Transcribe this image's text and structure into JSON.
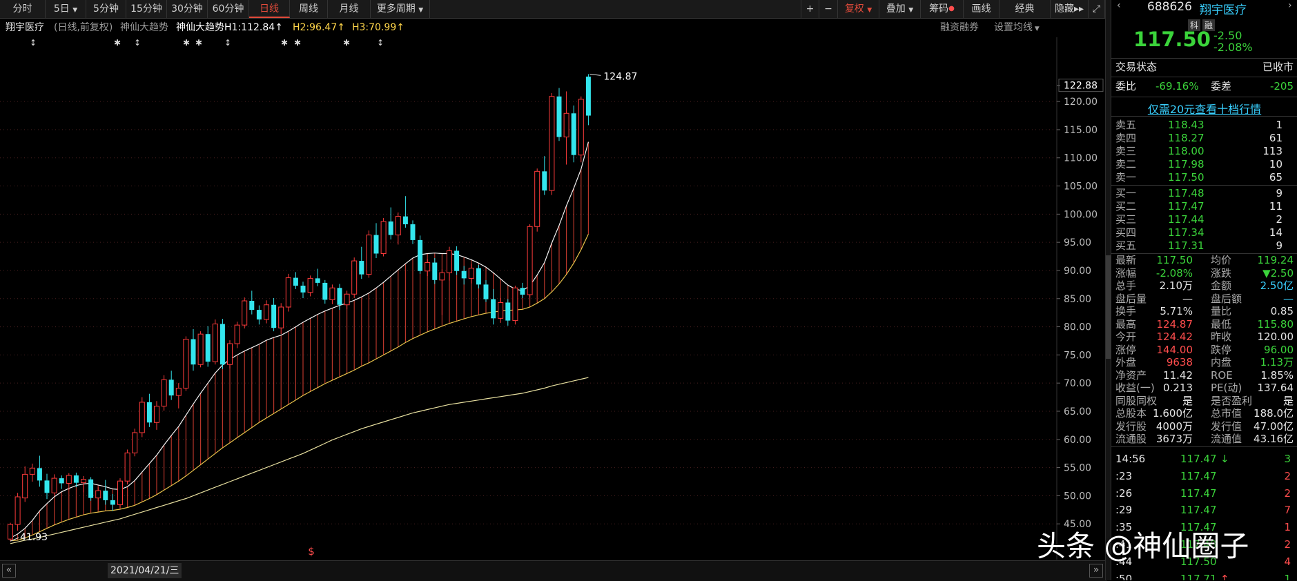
{
  "toolbar": {
    "periods": [
      "分时",
      "5日",
      "5分钟",
      "15分钟",
      "30分钟",
      "60分钟",
      "日线",
      "周线",
      "月线",
      "更多周期"
    ],
    "active_period": "日线",
    "plus": "+",
    "minus": "−",
    "fuquan": "复权",
    "diejia": "叠加",
    "chouma": "筹码",
    "huaxian": "画线",
    "jingdian": "经典",
    "yincang": "隐藏"
  },
  "infobar": {
    "stock_name": "翔宇医疗",
    "mode": "(日线,前复权)",
    "indicator": "神仙大趋势",
    "h1": "神仙大趋势H1:112.84",
    "h2": "H2:96.47",
    "h3": "H3:70.99",
    "margin_link": "融资融券",
    "ma_setting": "设置均线"
  },
  "chart_data": {
    "type": "candlestick",
    "price_axis": [
      122.88,
      120.0,
      115.0,
      110.0,
      105.0,
      100.0,
      95.0,
      90.0,
      85.0,
      80.0,
      75.0,
      70.0,
      65.0,
      60.0,
      55.0,
      50.0,
      45.0
    ],
    "ylim": [
      40.0,
      127.0
    ],
    "high_label": "124.87",
    "low_label": "41.93",
    "date_label": "2021/04/21/三",
    "ohlc": [
      [
        42.3,
        45.2,
        41.93,
        44.9
      ],
      [
        44.9,
        50.5,
        43.8,
        49.8
      ],
      [
        49.6,
        55.2,
        48.9,
        53.8
      ],
      [
        53.8,
        55.7,
        52.5,
        54.9
      ],
      [
        54.9,
        57.1,
        51.6,
        52.7
      ],
      [
        52.7,
        53.9,
        49.4,
        50.5
      ],
      [
        50.5,
        53.8,
        49.9,
        53.1
      ],
      [
        53.1,
        53.6,
        51.2,
        52.2
      ],
      [
        52.2,
        54.0,
        51.0,
        53.6
      ],
      [
        53.6,
        54.1,
        51.5,
        52.3
      ],
      [
        52.3,
        53.5,
        50.6,
        52.9
      ],
      [
        52.9,
        53.3,
        49.1,
        49.6
      ],
      [
        49.6,
        51.5,
        47.5,
        50.9
      ],
      [
        50.9,
        52.8,
        48.4,
        49.2
      ],
      [
        49.2,
        50.3,
        47.3,
        48.4
      ],
      [
        48.4,
        53.1,
        47.9,
        52.6
      ],
      [
        52.6,
        58.2,
        52.0,
        57.6
      ],
      [
        57.6,
        61.9,
        57.0,
        61.2
      ],
      [
        61.2,
        67.5,
        60.4,
        66.6
      ],
      [
        66.6,
        68.1,
        62.2,
        63.0
      ],
      [
        63.0,
        66.8,
        61.7,
        65.9
      ],
      [
        65.9,
        71.4,
        65.1,
        70.6
      ],
      [
        70.6,
        72.2,
        67.0,
        67.8
      ],
      [
        67.8,
        70.0,
        65.5,
        69.1
      ],
      [
        69.1,
        78.3,
        68.6,
        77.8
      ],
      [
        77.8,
        79.6,
        72.2,
        73.3
      ],
      [
        73.3,
        79.2,
        72.8,
        78.7
      ],
      [
        78.7,
        80.1,
        72.9,
        73.8
      ],
      [
        73.8,
        81.3,
        73.3,
        80.5
      ],
      [
        80.5,
        81.4,
        72.5,
        73.3
      ],
      [
        73.3,
        77.6,
        72.6,
        77.0
      ],
      [
        77.0,
        80.9,
        76.2,
        80.3
      ],
      [
        80.3,
        85.2,
        79.7,
        84.6
      ],
      [
        84.6,
        86.4,
        82.2,
        83.0
      ],
      [
        83.0,
        83.8,
        80.4,
        81.3
      ],
      [
        81.3,
        84.7,
        80.6,
        83.9
      ],
      [
        83.9,
        85.1,
        79.2,
        79.8
      ],
      [
        79.8,
        84.2,
        78.7,
        83.5
      ],
      [
        83.5,
        89.4,
        82.7,
        88.7
      ],
      [
        88.7,
        89.7,
        86.7,
        87.3
      ],
      [
        87.3,
        88.0,
        85.1,
        86.1
      ],
      [
        86.1,
        89.1,
        85.4,
        88.6
      ],
      [
        88.6,
        90.3,
        87.2,
        87.8
      ],
      [
        87.8,
        88.3,
        84.1,
        84.8
      ],
      [
        84.8,
        87.5,
        84.0,
        86.9
      ],
      [
        86.9,
        87.6,
        83.0,
        83.9
      ],
      [
        83.9,
        86.4,
        83.1,
        85.8
      ],
      [
        85.8,
        92.3,
        85.1,
        91.7
      ],
      [
        91.7,
        94.2,
        88.5,
        89.3
      ],
      [
        89.3,
        97.1,
        88.7,
        96.3
      ],
      [
        96.3,
        98.4,
        92.2,
        93.0
      ],
      [
        93.0,
        99.3,
        92.5,
        98.7
      ],
      [
        98.7,
        101.2,
        95.5,
        96.3
      ],
      [
        96.3,
        100.3,
        94.6,
        99.6
      ],
      [
        99.6,
        103.2,
        97.6,
        98.2
      ],
      [
        98.2,
        98.9,
        94.7,
        95.4
      ],
      [
        95.4,
        96.2,
        89.4,
        89.9
      ],
      [
        89.9,
        92.0,
        89.0,
        91.4
      ],
      [
        91.4,
        92.2,
        87.6,
        88.3
      ],
      [
        88.3,
        90.2,
        82.1,
        89.6
      ],
      [
        89.6,
        94.2,
        88.2,
        93.5
      ],
      [
        93.5,
        94.3,
        89.2,
        89.9
      ],
      [
        89.9,
        90.8,
        87.5,
        88.6
      ],
      [
        88.6,
        91.2,
        87.7,
        90.4
      ],
      [
        90.4,
        91.0,
        86.8,
        87.5
      ],
      [
        87.5,
        88.3,
        84.4,
        84.9
      ],
      [
        84.9,
        86.7,
        80.4,
        81.5
      ],
      [
        81.5,
        85.1,
        80.7,
        84.3
      ],
      [
        84.3,
        84.9,
        80.2,
        81.1
      ],
      [
        81.1,
        87.3,
        80.4,
        86.9
      ],
      [
        86.9,
        87.8,
        85.1,
        85.7
      ],
      [
        85.7,
        98.2,
        85.2,
        97.8
      ],
      [
        97.8,
        108.1,
        96.9,
        107.6
      ],
      [
        107.6,
        110.3,
        103.4,
        104.2
      ],
      [
        104.2,
        121.5,
        103.4,
        120.9
      ],
      [
        120.9,
        122.4,
        113.0,
        113.7
      ],
      [
        113.7,
        121.8,
        108.8,
        117.9
      ],
      [
        117.9,
        119.3,
        109.2,
        110.5
      ],
      [
        110.5,
        120.9,
        109.2,
        120.4
      ],
      [
        124.42,
        124.87,
        115.8,
        117.5
      ]
    ],
    "lines": {
      "h1": [
        42.5,
        43.2,
        44.2,
        45.6,
        47.3,
        48.6,
        49.8,
        50.7,
        51.3,
        51.8,
        52.1,
        52.2,
        51.9,
        51.6,
        51.2,
        51.1,
        51.6,
        52.7,
        54.2,
        55.7,
        57.2,
        59.0,
        60.7,
        62.3,
        64.3,
        66.3,
        68.2,
        70.0,
        71.8,
        73.2,
        74.2,
        75.0,
        75.7,
        76.3,
        76.9,
        77.6,
        78.1,
        78.5,
        79.2,
        80.0,
        80.8,
        81.5,
        82.2,
        82.8,
        83.3,
        83.8,
        84.2,
        84.7,
        85.3,
        86.0,
        86.9,
        87.9,
        89.0,
        90.1,
        91.2,
        92.2,
        92.8,
        93.0,
        93.1,
        93.0,
        93.0,
        92.8,
        92.4,
        91.9,
        91.3,
        90.6,
        89.6,
        88.5,
        87.4,
        86.7,
        86.4,
        87.3,
        89.2,
        91.4,
        94.9,
        98.0,
        101.5,
        104.6,
        108.0,
        112.84
      ],
      "h2": [
        42.0,
        42.1,
        42.5,
        43.0,
        43.6,
        44.2,
        44.8,
        45.3,
        45.8,
        46.2,
        46.6,
        46.9,
        47.1,
        47.3,
        47.4,
        47.6,
        47.9,
        48.3,
        48.9,
        49.5,
        50.2,
        51.0,
        51.8,
        52.6,
        53.5,
        54.5,
        55.5,
        56.5,
        57.5,
        58.5,
        59.4,
        60.3,
        61.2,
        62.1,
        63.0,
        63.8,
        64.6,
        65.4,
        66.2,
        67.0,
        67.8,
        68.5,
        69.2,
        69.9,
        70.5,
        71.1,
        71.7,
        72.3,
        73.0,
        73.6,
        74.3,
        75.0,
        75.7,
        76.4,
        77.2,
        77.9,
        78.5,
        79.1,
        79.6,
        80.1,
        80.6,
        81.0,
        81.4,
        81.8,
        82.1,
        82.4,
        82.6,
        82.8,
        82.9,
        83.0,
        83.1,
        83.5,
        84.2,
        85.0,
        86.2,
        87.6,
        89.3,
        91.3,
        93.7,
        96.47
      ],
      "h3": [
        41.5,
        41.8,
        42.1,
        42.3,
        42.6,
        42.9,
        43.2,
        43.5,
        43.8,
        44.1,
        44.4,
        44.7,
        45.0,
        45.3,
        45.6,
        45.9,
        46.3,
        46.7,
        47.1,
        47.5,
        47.9,
        48.3,
        48.7,
        49.1,
        49.5,
        50.0,
        50.5,
        51.0,
        51.5,
        52.0,
        52.5,
        53.0,
        53.5,
        54.0,
        54.5,
        55.0,
        55.5,
        56.0,
        56.5,
        57.0,
        57.5,
        58.1,
        58.7,
        59.3,
        59.9,
        60.4,
        60.9,
        61.4,
        61.9,
        62.3,
        62.7,
        63.1,
        63.5,
        63.9,
        64.3,
        64.7,
        65.0,
        65.3,
        65.6,
        65.9,
        66.2,
        66.4,
        66.6,
        66.8,
        67.0,
        67.2,
        67.4,
        67.6,
        67.8,
        68.0,
        68.2,
        68.5,
        68.8,
        69.1,
        69.5,
        69.8,
        70.1,
        70.4,
        70.7,
        70.99
      ]
    }
  },
  "bottombar": {
    "prev": "«",
    "next": "»"
  },
  "panel": {
    "code": "688626",
    "name": "翔宇医疗",
    "tag_ke": "科",
    "tag_rong": "融",
    "price": "117.50",
    "change": "-2.50",
    "change_pct": "-2.08%",
    "trade_status_label": "交易状态",
    "trade_status_value": "已收市",
    "weibi_label": "委比",
    "weibi_value": "-69.16%",
    "weicha_label": "委差",
    "weicha_value": "-205",
    "promo": "仅需20元查看十档行情",
    "asks": [
      {
        "label": "卖五",
        "price": "118.43",
        "vol": "1"
      },
      {
        "label": "卖四",
        "price": "118.27",
        "vol": "61"
      },
      {
        "label": "卖三",
        "price": "118.00",
        "vol": "113"
      },
      {
        "label": "卖二",
        "price": "117.98",
        "vol": "10"
      },
      {
        "label": "卖一",
        "price": "117.50",
        "vol": "65"
      }
    ],
    "bids": [
      {
        "label": "买一",
        "price": "117.48",
        "vol": "9"
      },
      {
        "label": "买二",
        "price": "117.47",
        "vol": "11"
      },
      {
        "label": "买三",
        "price": "117.44",
        "vol": "2"
      },
      {
        "label": "买四",
        "price": "117.34",
        "vol": "14"
      },
      {
        "label": "买五",
        "price": "117.31",
        "vol": "9"
      }
    ],
    "stats": [
      {
        "l1": "最新",
        "v1": "117.50",
        "c1": "g",
        "l2": "均价",
        "v2": "119.24",
        "c2": "g"
      },
      {
        "l1": "涨幅",
        "v1": "-2.08%",
        "c1": "g",
        "l2": "涨跌",
        "v2": "▼2.50",
        "c2": "g"
      },
      {
        "l1": "总手",
        "v1": "2.10万",
        "c1": "w",
        "l2": "金额",
        "v2": "2.50亿",
        "c2": "c"
      },
      {
        "l1": "盘后量",
        "v1": "—",
        "c1": "w",
        "l2": "盘后额",
        "v2": "—",
        "c2": "c"
      },
      {
        "l1": "换手",
        "v1": "5.71%",
        "c1": "w",
        "l2": "量比",
        "v2": "0.85",
        "c2": "w"
      },
      {
        "l1": "最高",
        "v1": "124.87",
        "c1": "r",
        "l2": "最低",
        "v2": "115.80",
        "c2": "g"
      },
      {
        "l1": "今开",
        "v1": "124.42",
        "c1": "r",
        "l2": "昨收",
        "v2": "120.00",
        "c2": "w"
      },
      {
        "l1": "涨停",
        "v1": "144.00",
        "c1": "r",
        "l2": "跌停",
        "v2": "96.00",
        "c2": "g"
      },
      {
        "l1": "外盘",
        "v1": "9638",
        "c1": "r",
        "l2": "内盘",
        "v2": "1.13万",
        "c2": "g"
      },
      {
        "l1": "净资产",
        "v1": "11.42",
        "c1": "w",
        "l2": "ROE",
        "v2": "1.85%",
        "c2": "w"
      },
      {
        "l1": "收益(一)",
        "v1": "0.213",
        "c1": "w",
        "l2": "PE(动)",
        "v2": "137.64",
        "c2": "w"
      },
      {
        "l1": "同股同权",
        "v1": "是",
        "c1": "w",
        "l2": "是否盈利",
        "v2": "是",
        "c2": "w"
      },
      {
        "l1": "总股本",
        "v1": "1.600亿",
        "c1": "w",
        "l2": "总市值",
        "v2": "188.0亿",
        "c2": "w"
      },
      {
        "l1": "发行股",
        "v1": "4000万",
        "c1": "w",
        "l2": "发行值",
        "v2": "47.00亿",
        "c2": "w"
      },
      {
        "l1": "流通股",
        "v1": "3673万",
        "c1": "w",
        "l2": "流通值",
        "v2": "43.16亿",
        "c2": "w"
      }
    ],
    "ticks": [
      {
        "time": "14:56",
        "price": "117.47",
        "arrow": "↓",
        "vol": "3",
        "vc": "g"
      },
      {
        "time": ":23",
        "price": "117.47",
        "arrow": "",
        "vol": "2",
        "vc": "r"
      },
      {
        "time": ":26",
        "price": "117.47",
        "arrow": "",
        "vol": "2",
        "vc": "r"
      },
      {
        "time": ":29",
        "price": "117.47",
        "arrow": "",
        "vol": "7",
        "vc": "r"
      },
      {
        "time": ":35",
        "price": "117.47",
        "arrow": "",
        "vol": "1",
        "vc": "r"
      },
      {
        "time": ":41",
        "price": "117.48",
        "arrow": "",
        "vol": "2",
        "vc": "r"
      },
      {
        "time": ":44",
        "price": "117.50",
        "arrow": "",
        "vol": "4",
        "vc": "r"
      },
      {
        "time": ":50",
        "price": "117.71",
        "arrow": "↑",
        "vol": "1",
        "vc": "g"
      }
    ]
  },
  "watermark": "头条 @神仙圈子"
}
